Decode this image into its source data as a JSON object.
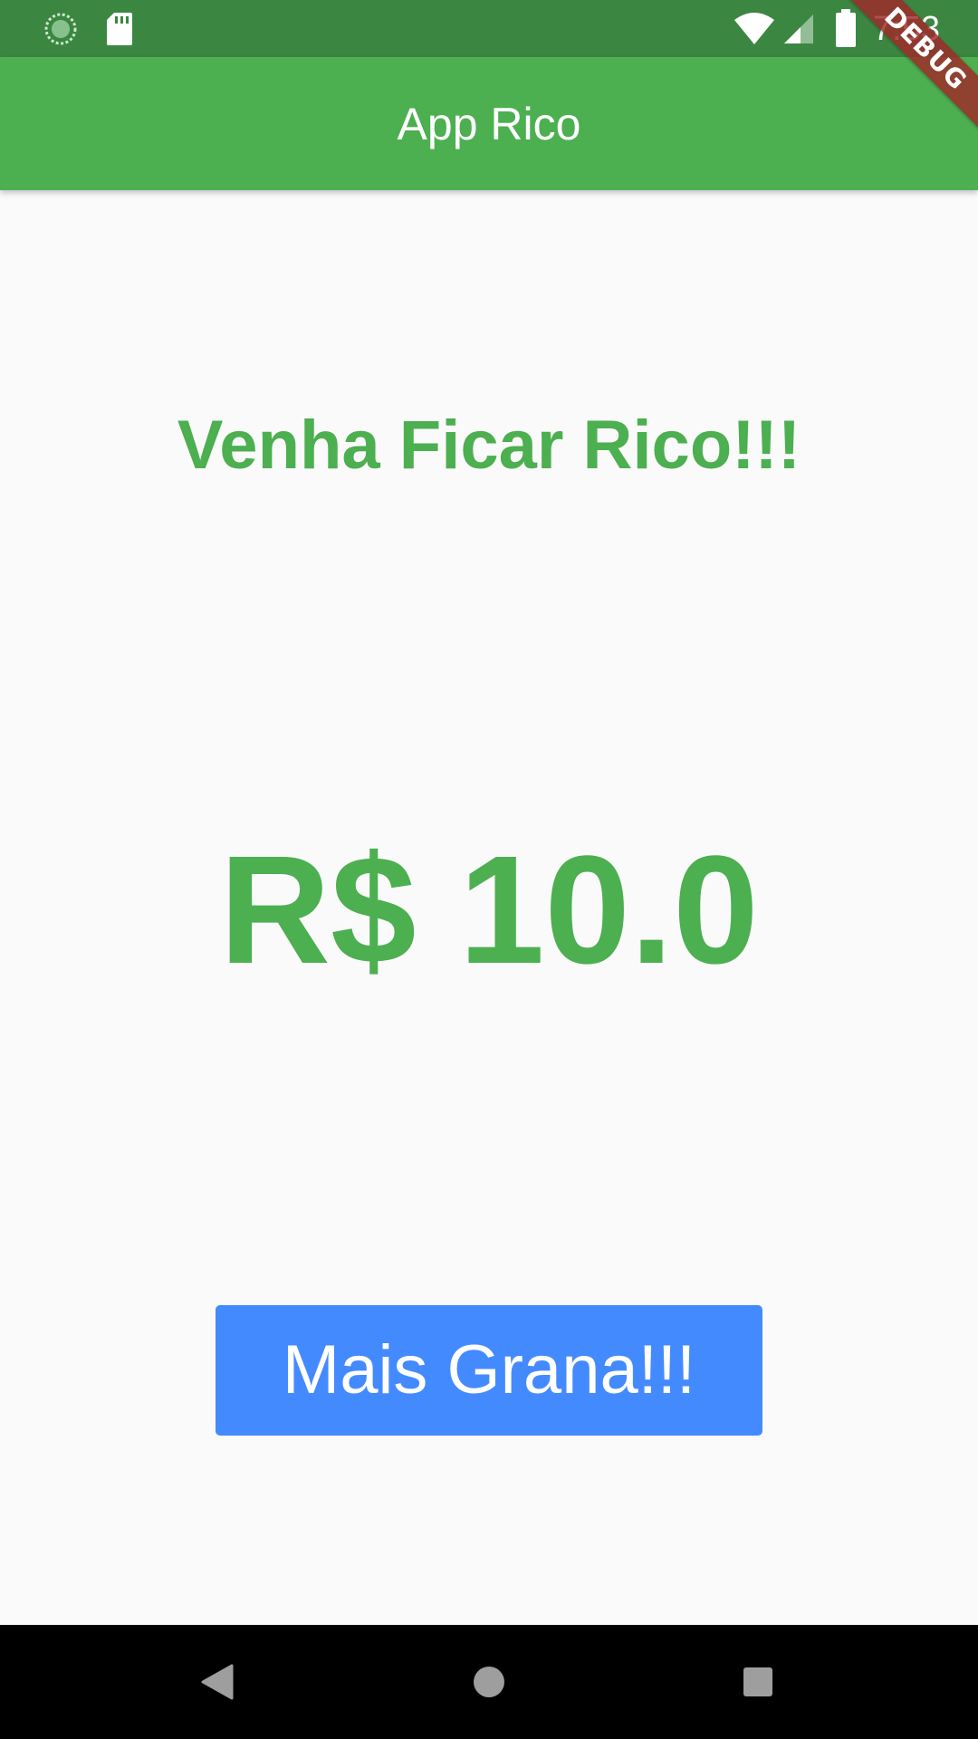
{
  "status_bar": {
    "time": "7:53",
    "icons": [
      "sync-icon",
      "sd-card-icon",
      "wifi-icon",
      "signal-icon",
      "battery-icon"
    ]
  },
  "app_bar": {
    "title": "App Rico",
    "color": "#4caf50"
  },
  "debug_banner": {
    "label": "DEBUG"
  },
  "main": {
    "headline": "Venha Ficar Rico!!!",
    "amount": "R$ 10.0",
    "button_label": "Mais Grana!!!",
    "accent_color": "#4caf50",
    "button_color": "#448aff"
  },
  "nav_bar": {
    "buttons": [
      "back-icon",
      "home-icon",
      "recents-icon"
    ]
  }
}
